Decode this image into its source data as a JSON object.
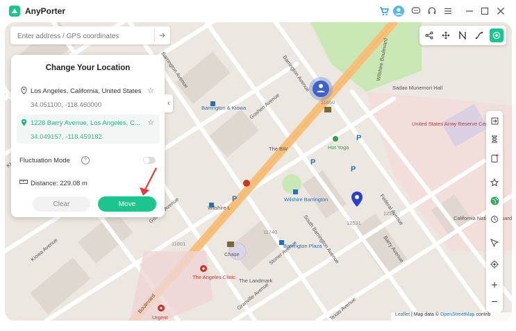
{
  "app": {
    "title": "AnyPorter",
    "colors": {
      "accent": "#1dc58e",
      "blue_pin": "#2a3fd1",
      "road_major": "#f6c07a",
      "park": "#c9e8b5"
    }
  },
  "titlebar_icons": [
    "cart-icon",
    "user-avatar-icon",
    "chat-icon",
    "headset-icon",
    "menu-icon",
    "minimize-icon",
    "maximize-icon",
    "close-icon"
  ],
  "search": {
    "placeholder": "Enter address / GPS coordinates"
  },
  "panel": {
    "title": "Change Your Location",
    "locations": [
      {
        "name": "Los Angeles, California, United States",
        "coords": "34.051100, -118.460000"
      },
      {
        "name": "1228 Barry Avenue, Los Angeles, C...",
        "coords": "34.049157, -118.459182"
      }
    ],
    "fluctuation_label": "Fluctuation Mode",
    "distance_label": "Distance: 229.08 m",
    "clear_label": "Clear",
    "move_label": "Move"
  },
  "toolbar_top": [
    "share-route-icon",
    "joystick-icon",
    "multi-stop-icon",
    "one-stop-icon",
    "teleport-icon"
  ],
  "side_tools": [
    "import-icon",
    "hourglass-icon",
    "device-icon",
    "favorite-icon",
    "globe-icon",
    "history-icon",
    "navigate-icon",
    "locate-icon",
    "zoom-in-icon",
    "zoom-out-icon"
  ],
  "map_labels": {
    "wilshire_blvd": "Wilshire Boulevard",
    "kiowa_1": "Kiowa Avenue",
    "kiowa_2": "Kiowa Avenue",
    "kiowa_3": "Kiowa Avenue",
    "barrington_top": "Barrington Avenue",
    "barrington_kiowa": "Barrington & Kiowa",
    "goshen": "Goshen Avenue",
    "goshen_2": "Goshen Avenue",
    "sadao": "Sadao Munemori Hall",
    "army": "United States Army Reserve Center",
    "federal": "Federal Avenue",
    "hot_yoga": "Hot Yoga",
    "the_bw": "The BW",
    "wilshire_barrington": "Wilshire Barrington",
    "wilshire_l": "Wilshire L",
    "s_barrington": "South Barrington Avenue",
    "barry": "Barry Avenue",
    "barry_2": "Barry Avenue",
    "barrington_plaza": "Barrington Plaza",
    "chase": "Chase",
    "the_angeles_clinic": "The Angeles Clinic",
    "the_landmark": "The Landmark",
    "stoner": "Stoner Avenue",
    "granville": "Granville Avenue",
    "texas": "Texas Avenue",
    "california_guard": "California National Guard",
    "urgent": "Urgent",
    "num_11601": "11601",
    "num_11740": "11740",
    "num_12531": "12531",
    "num_1252": "1252",
    "num_11650": "11650",
    "boulevard": "Boulevard",
    "parking": "P"
  },
  "attribution": {
    "leaflet": "Leaflet",
    "sep": " | Map data © ",
    "osm": "OpenStreetMap",
    "tail": " contrib"
  }
}
